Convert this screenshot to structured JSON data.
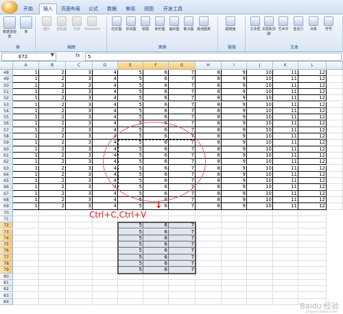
{
  "tabs": [
    "开始",
    "插入",
    "页面布局",
    "公式",
    "数据",
    "审阅",
    "视图",
    "开发工具"
  ],
  "active_tab": 1,
  "ribbon": {
    "groups": [
      {
        "label": "表",
        "buttons": [
          "数据透视表",
          "表"
        ]
      },
      {
        "label": "插图",
        "buttons": [
          "图片",
          "剪贴画",
          "形状",
          "SmartArt"
        ]
      },
      {
        "label": "图表",
        "buttons": [
          "柱形图",
          "折线图",
          "饼图",
          "条形图",
          "面积图",
          "散点图",
          "其他图表"
        ]
      },
      {
        "label": "链接",
        "buttons": [
          "超链接"
        ]
      },
      {
        "label": "文本",
        "buttons": [
          "文本框",
          "页眉和页脚",
          "艺术字",
          "签名行",
          "对象",
          "符号"
        ]
      }
    ]
  },
  "formula_bar": {
    "name_box": "E72",
    "fx": "fx",
    "formula": "5"
  },
  "columns": [
    "A",
    "B",
    "C",
    "D",
    "E",
    "F",
    "G",
    "H",
    "I",
    "J",
    "K",
    "L"
  ],
  "selected_columns": [
    "E",
    "F",
    "G"
  ],
  "row_values": [
    "1",
    "2",
    "3",
    "4",
    "5",
    "6",
    "7",
    "8",
    "9",
    "10",
    "11",
    "12"
  ],
  "data_rows": [
    "48",
    "49",
    "50",
    "51",
    "52",
    "53",
    "54",
    "55",
    "56",
    "57",
    "58",
    "59",
    "60",
    "61",
    "62",
    "63",
    "64",
    "65",
    "66",
    "67",
    "68",
    "69"
  ],
  "empty_rows": [
    "70",
    "71"
  ],
  "pasted_rows": [
    "72",
    "73",
    "74",
    "75",
    "76",
    "77",
    "78",
    "79"
  ],
  "pasted_values": [
    "5",
    "6",
    "7"
  ],
  "tail_rows": [
    "80",
    "81",
    "82",
    "83",
    "84"
  ],
  "annotation": "Ctrl+C,Ctrl+V",
  "arrow_glyph": "↓",
  "watermark": "Baidu 经验",
  "watermark_sub": "jingyan.baidu.com",
  "colors": {
    "annotation": "#e11c1c",
    "selection_header": "#f9c86d",
    "paste_fill": "#dfe4ee"
  }
}
